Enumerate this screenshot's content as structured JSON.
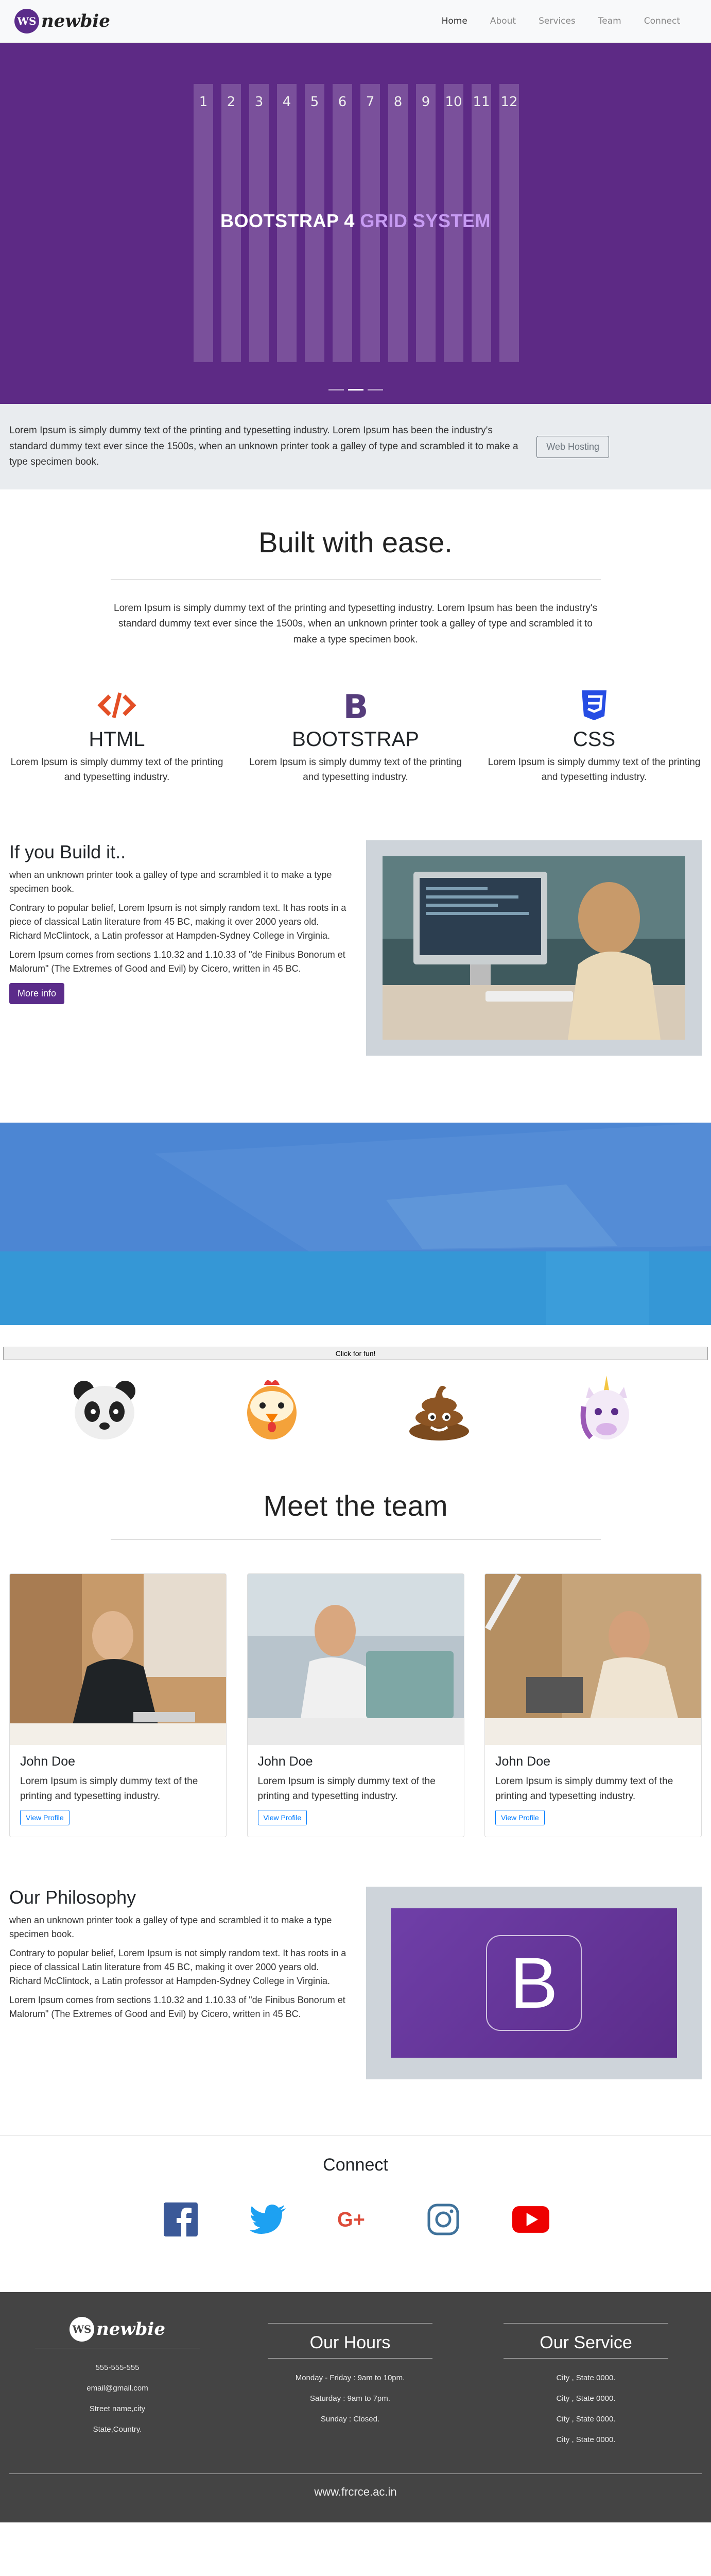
{
  "nav": {
    "brand_mark": "WS",
    "brand_text": "newbie",
    "links": [
      "Home",
      "About",
      "Services",
      "Team",
      "Connect"
    ]
  },
  "hero": {
    "columns": [
      "1",
      "2",
      "3",
      "4",
      "5",
      "6",
      "7",
      "8",
      "9",
      "10",
      "11",
      "12"
    ],
    "title_main": "BOOTSTRAP 4",
    "title_accent": "GRID SYSTEM",
    "background": "#5d2a85"
  },
  "info": {
    "text": "Lorem Ipsum is simply dummy text of the printing and typesetting industry. Lorem Ipsum has been the industry's standard dummy text ever since the 1500s, when an unknown printer took a galley of type and scrambled it to make a type specimen book.",
    "button": "Web Hosting"
  },
  "built": {
    "title": "Built with ease.",
    "lead": "Lorem Ipsum is simply dummy text of the printing and typesetting industry. Lorem Ipsum has been the industry's standard dummy text ever since the 1500s, when an unknown printer took a galley of type and scrambled it to make a type specimen book.",
    "features": [
      {
        "title": "HTML",
        "text": "Lorem Ipsum is simply dummy text of the printing and typesetting industry.",
        "icon": "code-icon",
        "color": "#e34f26"
      },
      {
        "title": "BOOTSTRAP",
        "text": "Lorem Ipsum is simply dummy text of the printing and typesetting industry.",
        "icon": "bootstrap-icon",
        "color": "#563d7c"
      },
      {
        "title": "CSS",
        "text": "Lorem Ipsum is simply dummy text of the printing and typesetting industry.",
        "icon": "css3-icon",
        "color": "#264de4"
      }
    ]
  },
  "build": {
    "title": "If you Build it..",
    "p1": "when an unknown printer took a galley of type and scrambled it to make a type specimen book.",
    "p2": "Contrary to popular belief, Lorem Ipsum is not simply random text. It has roots in a piece of classical Latin literature from 45 BC, making it over 2000 years old. Richard McClintock, a Latin professor at Hampden-Sydney College in Virginia.",
    "p3": "Lorem Ipsum comes from sections 1.10.32 and 1.10.33 of \"de Finibus Bonorum et Malorum\" (The Extremes of Good and Evil) by Cicero, written in 45 BC.",
    "button": "More info"
  },
  "fun": {
    "button": "Click for fun!",
    "emojis": [
      "panda-emoji",
      "chicken-emoji",
      "poop-emoji",
      "unicorn-emoji"
    ]
  },
  "team": {
    "title": "Meet the team",
    "members": [
      {
        "name": "John Doe",
        "text": "Lorem Ipsum is simply dummy text of the printing and typesetting industry.",
        "button": "View Profile"
      },
      {
        "name": "John Doe",
        "text": "Lorem Ipsum is simply dummy text of the printing and typesetting industry.",
        "button": "View Profile"
      },
      {
        "name": "John Doe",
        "text": "Lorem Ipsum is simply dummy text of the printing and typesetting industry.",
        "button": "View Profile"
      }
    ]
  },
  "philosophy": {
    "title": "Our Philosophy",
    "p1": "when an unknown printer took a galley of type and scrambled it to make a type specimen book.",
    "p2": "Contrary to popular belief, Lorem Ipsum is not simply random text. It has roots in a piece of classical Latin literature from 45 BC, making it over 2000 years old. Richard McClintock, a Latin professor at Hampden-Sydney College in Virginia.",
    "p3": "Lorem Ipsum comes from sections 1.10.32 and 1.10.33 of \"de Finibus Bonorum et Malorum\" (The Extremes of Good and Evil) by Cicero, written in 45 BC.",
    "logo_letter": "B"
  },
  "connect": {
    "title": "Connect",
    "socials": [
      "facebook-icon",
      "twitter-icon",
      "google-plus-icon",
      "instagram-icon",
      "youtube-icon"
    ]
  },
  "footer": {
    "brand_mark": "WS",
    "brand_text": "newbie",
    "contact": [
      "555-555-555",
      "email@gmail.com",
      "Street name,city",
      "State,Country."
    ],
    "hours_title": "Our Hours",
    "hours": [
      "Monday - Friday : 9am to 10pm.",
      "Saturday : 9am to 7pm.",
      "Sunday : Closed."
    ],
    "service_title": "Our Service",
    "services": [
      "City , State 0000.",
      "City , State 0000.",
      "City , State 0000.",
      "City , State 0000."
    ],
    "site": "www.frcrce.ac.in"
  }
}
